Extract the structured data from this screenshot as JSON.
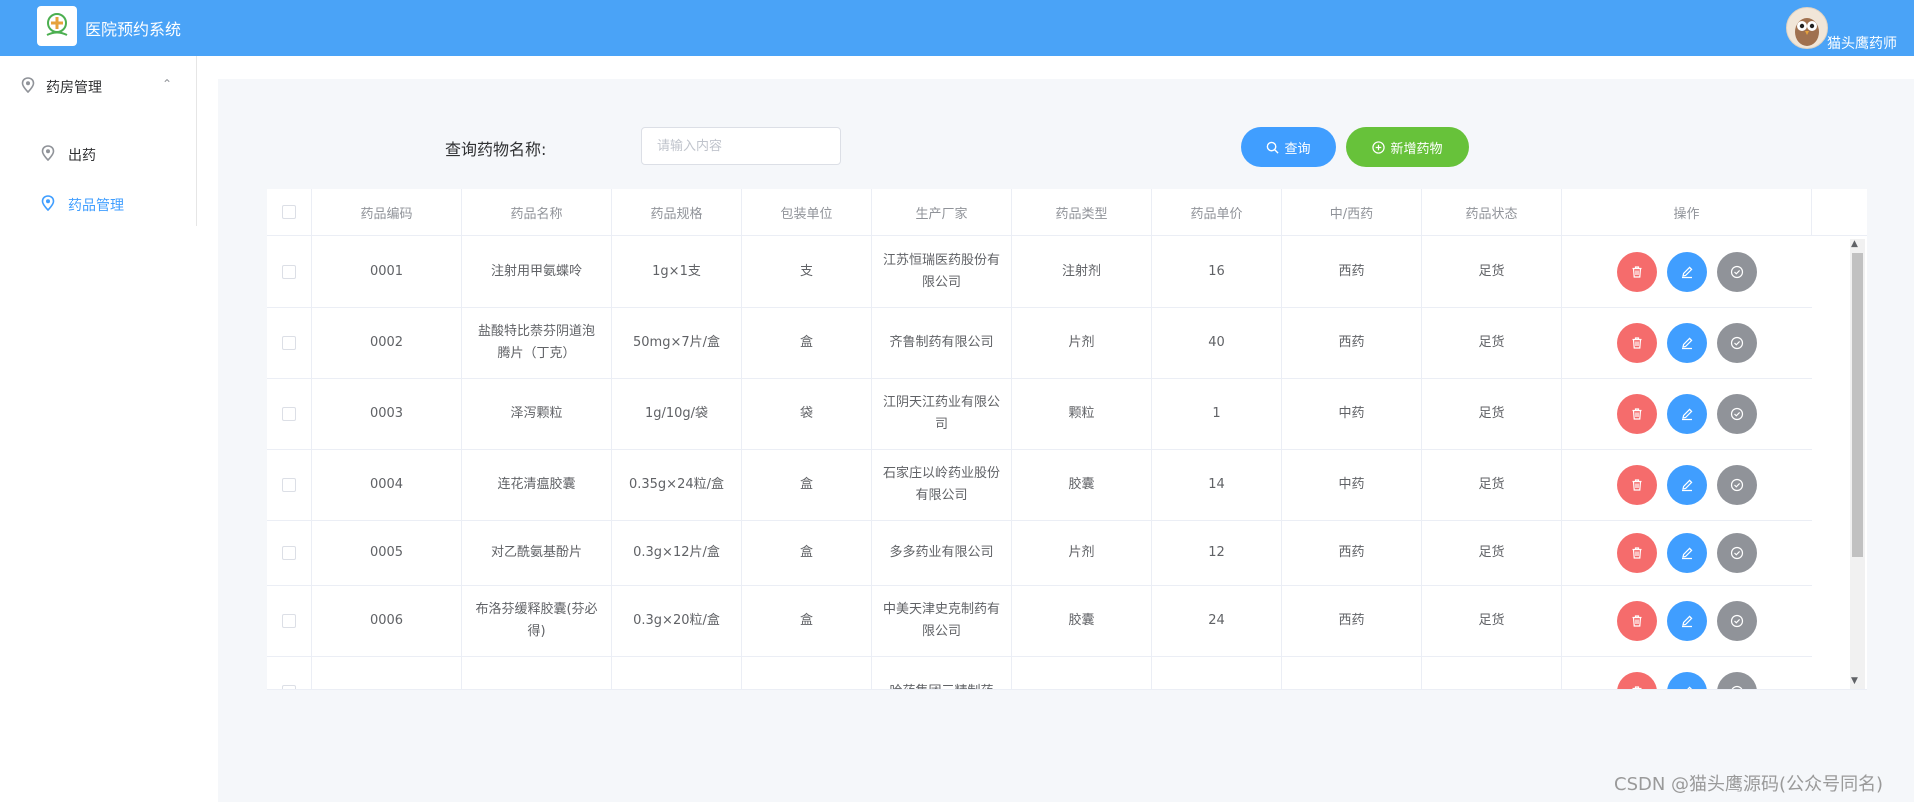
{
  "app": {
    "title": "医院预约系统",
    "username": "猫头鹰药师"
  },
  "sidebar": {
    "group": {
      "label": "药房管理",
      "expanded": true
    },
    "items": [
      {
        "label": "出药",
        "active": false
      },
      {
        "label": "药品管理",
        "active": true
      }
    ]
  },
  "search": {
    "label": "查询药物名称:",
    "placeholder": "请输入内容",
    "value": ""
  },
  "toolbar": {
    "query_label": "查询",
    "add_label": "新增药物"
  },
  "table": {
    "columns": [
      "药品编码",
      "药品名称",
      "药品规格",
      "包装单位",
      "生产厂家",
      "药品类型",
      "药品单价",
      "中/西药",
      "药品状态",
      "操作"
    ],
    "rows": [
      {
        "code": "0001",
        "name": "注射用甲氨蝶呤",
        "spec": "1g×1支",
        "unit": "支",
        "maker": "江苏恒瑞医药股份有限公司",
        "type": "注射剂",
        "price": "16",
        "category": "西药",
        "status": "足货"
      },
      {
        "code": "0002",
        "name": "盐酸特比萘芬阴道泡腾片（丁克）",
        "spec": "50mg×7片/盒",
        "unit": "盒",
        "maker": "齐鲁制药有限公司",
        "type": "片剂",
        "price": "40",
        "category": "西药",
        "status": "足货"
      },
      {
        "code": "0003",
        "name": "泽泻颗粒",
        "spec": "1g/10g/袋",
        "unit": "袋",
        "maker": "江阴天江药业有限公司",
        "type": "颗粒",
        "price": "1",
        "category": "中药",
        "status": "足货"
      },
      {
        "code": "0004",
        "name": "连花清瘟胶囊",
        "spec": "0.35g×24粒/盒",
        "unit": "盒",
        "maker": "石家庄以岭药业股份有限公司",
        "type": "胶囊",
        "price": "14",
        "category": "中药",
        "status": "足货"
      },
      {
        "code": "0005",
        "name": "对乙酰氨基酚片",
        "spec": "0.3g×12片/盒",
        "unit": "盒",
        "maker": "多多药业有限公司",
        "type": "片剂",
        "price": "12",
        "category": "西药",
        "status": "足货"
      },
      {
        "code": "0006",
        "name": "布洛芬缓释胶囊(芬必得)",
        "spec": "0.3g×20粒/盒",
        "unit": "盒",
        "maker": "中美天津史克制药有限公司",
        "type": "胶囊",
        "price": "24",
        "category": "西药",
        "status": "足货"
      },
      {
        "code": "",
        "name": "",
        "spec": "",
        "unit": "",
        "maker": "哈药集团三精制药",
        "type": "",
        "price": "",
        "category": "",
        "status": ""
      }
    ]
  },
  "watermark": "CSDN @猫头鹰源码(公众号同名)",
  "colors": {
    "header": "#4aa3f7",
    "primary": "#409eff",
    "success": "#67c23a",
    "danger": "#f56c6c",
    "info": "#909399"
  },
  "icons": [
    "location-icon",
    "chevron-up-icon",
    "search-icon",
    "plus-circle-icon",
    "delete-icon",
    "edit-icon",
    "check-circle-icon"
  ]
}
